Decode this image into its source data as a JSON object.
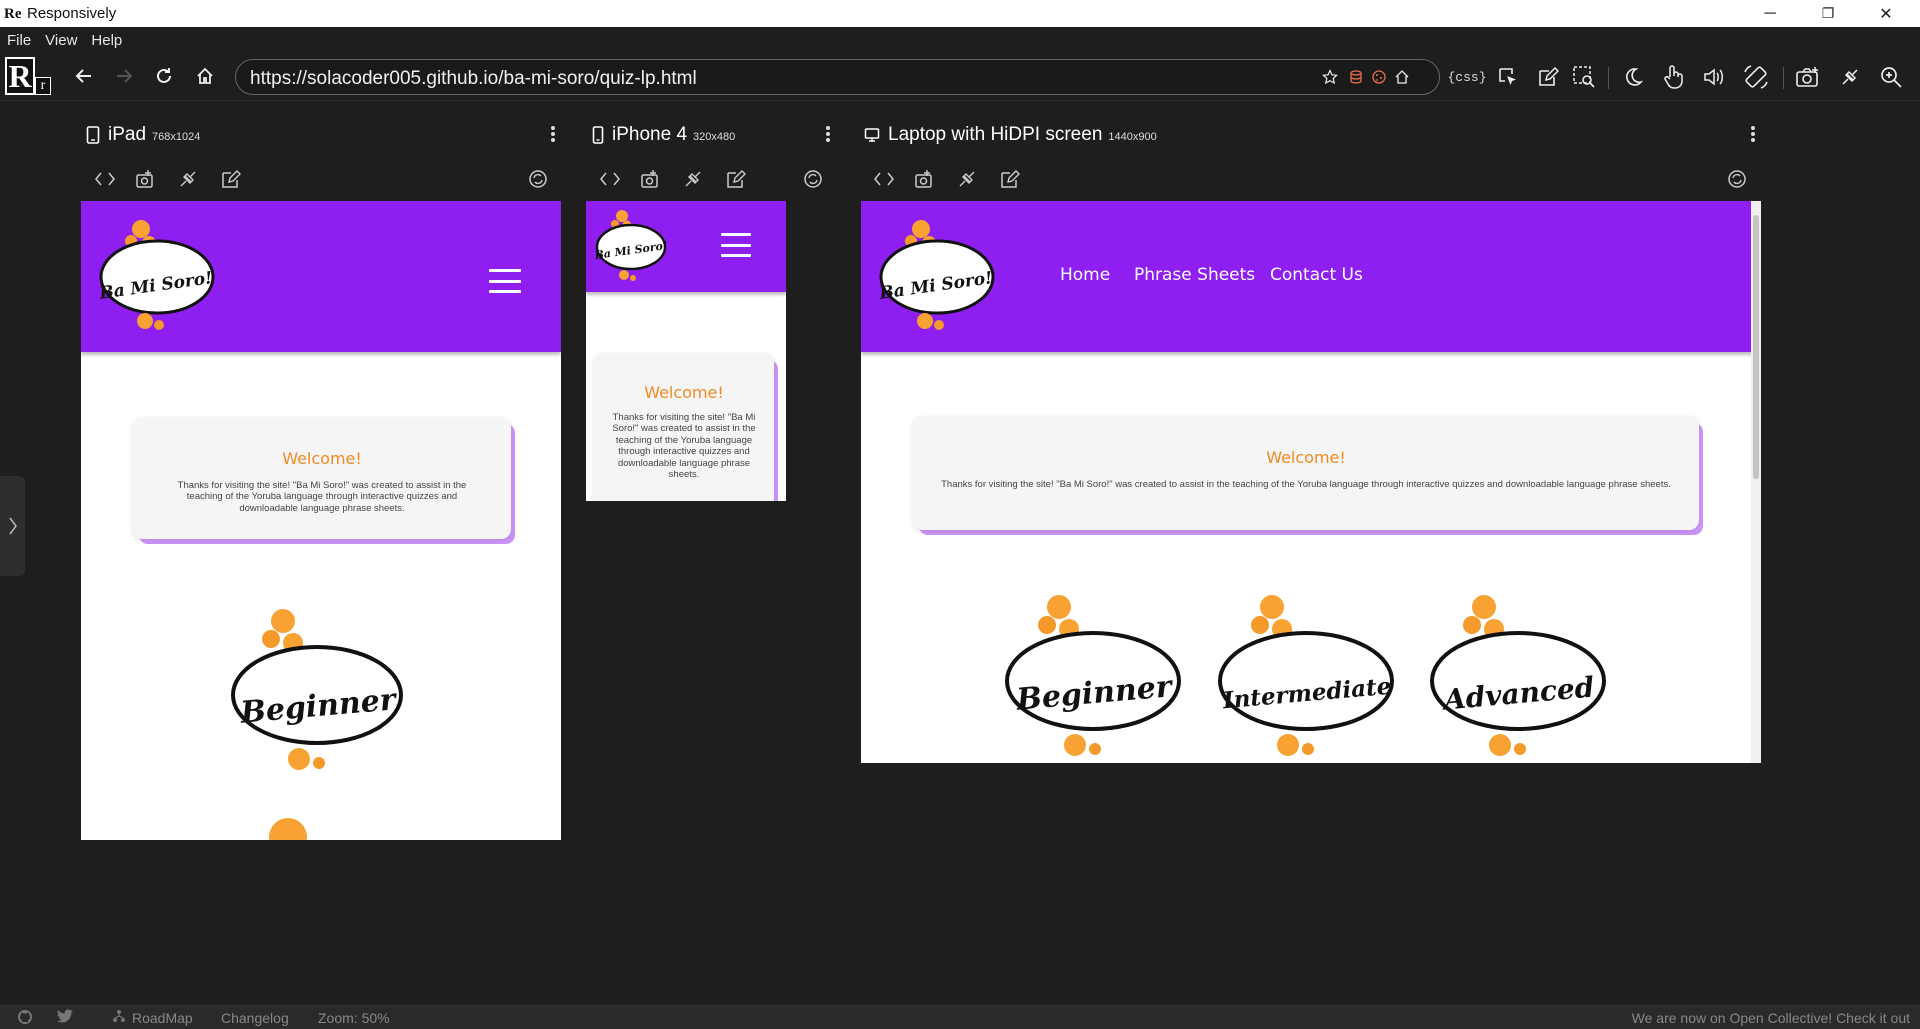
{
  "window": {
    "title": "Responsively",
    "app_icon": "Re",
    "minimize": "─",
    "restore": "❐",
    "close": "✕"
  },
  "menu": {
    "items": [
      "File",
      "View",
      "Help"
    ]
  },
  "toolbar": {
    "logo_big": "R",
    "logo_small": "r",
    "url": "https://solacoder005.github.io/ba-mi-soro/quiz-lp.html",
    "css_label": "{css}"
  },
  "devices": [
    {
      "name": "iPad",
      "size": "768x1024",
      "icon": "tablet-icon"
    },
    {
      "name": "iPhone 4",
      "size": "320x480",
      "icon": "phone-icon"
    },
    {
      "name": "Laptop with HiDPI screen",
      "size": "1440x900",
      "icon": "laptop-icon"
    }
  ],
  "site": {
    "logo_text": "Ba Mi Soro!",
    "nav": [
      "Home",
      "Phrase Sheets",
      "Contact Us"
    ],
    "welcome_title": "Welcome!",
    "welcome_text": "Thanks for visiting the site! \"Ba Mi Soro!\" was created to assist in the teaching of the Yoruba language through interactive quizzes and downloadable language phrase sheets.",
    "levels": [
      "Beginner",
      "Intermediate",
      "Advanced"
    ],
    "brand_color": "#8e1ff0",
    "accent_color": "#f08a24"
  },
  "statusbar": {
    "roadmap": "RoadMap",
    "changelog": "Changelog",
    "zoom": "Zoom: 50%",
    "promo": "We are now on Open Collective! Check it out"
  }
}
